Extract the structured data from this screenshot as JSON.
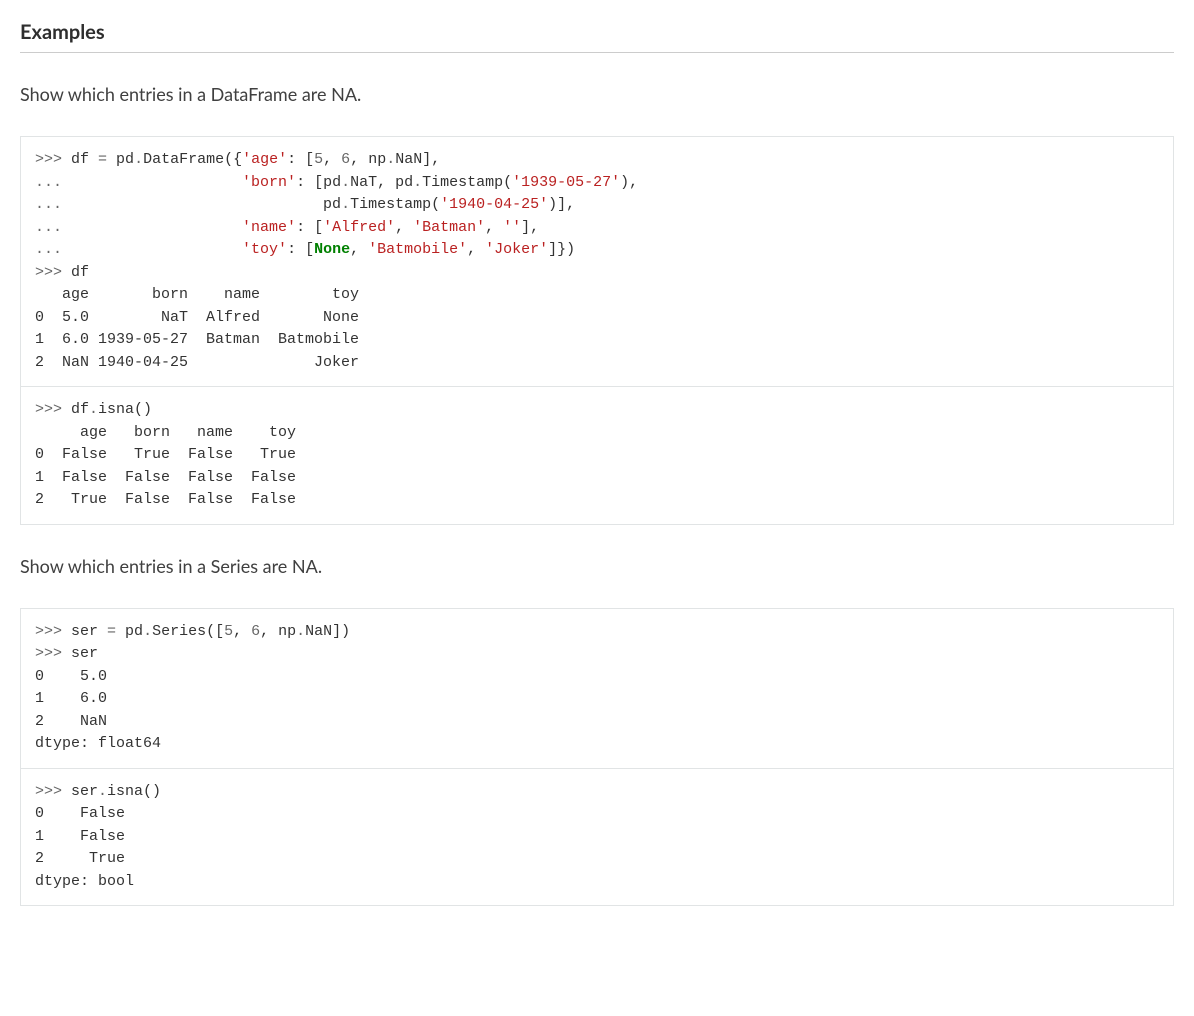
{
  "heading": "Examples",
  "descriptions": {
    "dataframe": "Show which entries in a DataFrame are NA.",
    "series": "Show which entries in a Series are NA."
  },
  "code": {
    "block1": [
      {
        "type": "op",
        "text": ">>> "
      },
      {
        "type": "plain",
        "text": "df "
      },
      {
        "type": "op",
        "text": "= "
      },
      {
        "type": "plain",
        "text": "pd"
      },
      {
        "type": "op",
        "text": "."
      },
      {
        "type": "plain",
        "text": "DataFrame({"
      },
      {
        "type": "str",
        "text": "'age'"
      },
      {
        "type": "plain",
        "text": ": ["
      },
      {
        "type": "num",
        "text": "5"
      },
      {
        "type": "plain",
        "text": ", "
      },
      {
        "type": "num",
        "text": "6"
      },
      {
        "type": "plain",
        "text": ", np"
      },
      {
        "type": "op",
        "text": "."
      },
      {
        "type": "plain",
        "text": "NaN],\n"
      },
      {
        "type": "op",
        "text": "... "
      },
      {
        "type": "plain",
        "text": "                   "
      },
      {
        "type": "str",
        "text": "'born'"
      },
      {
        "type": "plain",
        "text": ": [pd"
      },
      {
        "type": "op",
        "text": "."
      },
      {
        "type": "plain",
        "text": "NaT, pd"
      },
      {
        "type": "op",
        "text": "."
      },
      {
        "type": "plain",
        "text": "Timestamp("
      },
      {
        "type": "str",
        "text": "'1939-05-27'"
      },
      {
        "type": "plain",
        "text": "),\n"
      },
      {
        "type": "op",
        "text": "... "
      },
      {
        "type": "plain",
        "text": "                            pd"
      },
      {
        "type": "op",
        "text": "."
      },
      {
        "type": "plain",
        "text": "Timestamp("
      },
      {
        "type": "str",
        "text": "'1940-04-25'"
      },
      {
        "type": "plain",
        "text": ")],\n"
      },
      {
        "type": "op",
        "text": "... "
      },
      {
        "type": "plain",
        "text": "                   "
      },
      {
        "type": "str",
        "text": "'name'"
      },
      {
        "type": "plain",
        "text": ": ["
      },
      {
        "type": "str",
        "text": "'Alfred'"
      },
      {
        "type": "plain",
        "text": ", "
      },
      {
        "type": "str",
        "text": "'Batman'"
      },
      {
        "type": "plain",
        "text": ", "
      },
      {
        "type": "str",
        "text": "''"
      },
      {
        "type": "plain",
        "text": "],\n"
      },
      {
        "type": "op",
        "text": "... "
      },
      {
        "type": "plain",
        "text": "                   "
      },
      {
        "type": "str",
        "text": "'toy'"
      },
      {
        "type": "plain",
        "text": ": ["
      },
      {
        "type": "kw",
        "text": "None"
      },
      {
        "type": "plain",
        "text": ", "
      },
      {
        "type": "str",
        "text": "'Batmobile'"
      },
      {
        "type": "plain",
        "text": ", "
      },
      {
        "type": "str",
        "text": "'Joker'"
      },
      {
        "type": "plain",
        "text": "]})\n"
      },
      {
        "type": "op",
        "text": ">>> "
      },
      {
        "type": "plain",
        "text": "df\n"
      },
      {
        "type": "out",
        "text": "   age       born    name        toy\n0  5.0        NaT  Alfred       None\n1  6.0 1939-05-27  Batman  Batmobile\n2  NaN 1940-04-25              Joker"
      }
    ],
    "block2": [
      {
        "type": "op",
        "text": ">>> "
      },
      {
        "type": "plain",
        "text": "df"
      },
      {
        "type": "op",
        "text": "."
      },
      {
        "type": "plain",
        "text": "isna()\n"
      },
      {
        "type": "out",
        "text": "     age   born   name    toy\n0  False   True  False   True\n1  False  False  False  False\n2   True  False  False  False"
      }
    ],
    "block3": [
      {
        "type": "op",
        "text": ">>> "
      },
      {
        "type": "plain",
        "text": "ser "
      },
      {
        "type": "op",
        "text": "= "
      },
      {
        "type": "plain",
        "text": "pd"
      },
      {
        "type": "op",
        "text": "."
      },
      {
        "type": "plain",
        "text": "Series(["
      },
      {
        "type": "num",
        "text": "5"
      },
      {
        "type": "plain",
        "text": ", "
      },
      {
        "type": "num",
        "text": "6"
      },
      {
        "type": "plain",
        "text": ", np"
      },
      {
        "type": "op",
        "text": "."
      },
      {
        "type": "plain",
        "text": "NaN])\n"
      },
      {
        "type": "op",
        "text": ">>> "
      },
      {
        "type": "plain",
        "text": "ser\n"
      },
      {
        "type": "out",
        "text": "0    5.0\n1    6.0\n2    NaN\ndtype: float64"
      }
    ],
    "block4": [
      {
        "type": "op",
        "text": ">>> "
      },
      {
        "type": "plain",
        "text": "ser"
      },
      {
        "type": "op",
        "text": "."
      },
      {
        "type": "plain",
        "text": "isna()\n"
      },
      {
        "type": "out",
        "text": "0    False\n1    False\n2     True\ndtype: bool"
      }
    ]
  },
  "syntax_colors": {
    "op": "#666666",
    "str": "#BA2121",
    "num": "#666666",
    "kw": "#008000",
    "plain": "#333333",
    "out": "#333333"
  }
}
